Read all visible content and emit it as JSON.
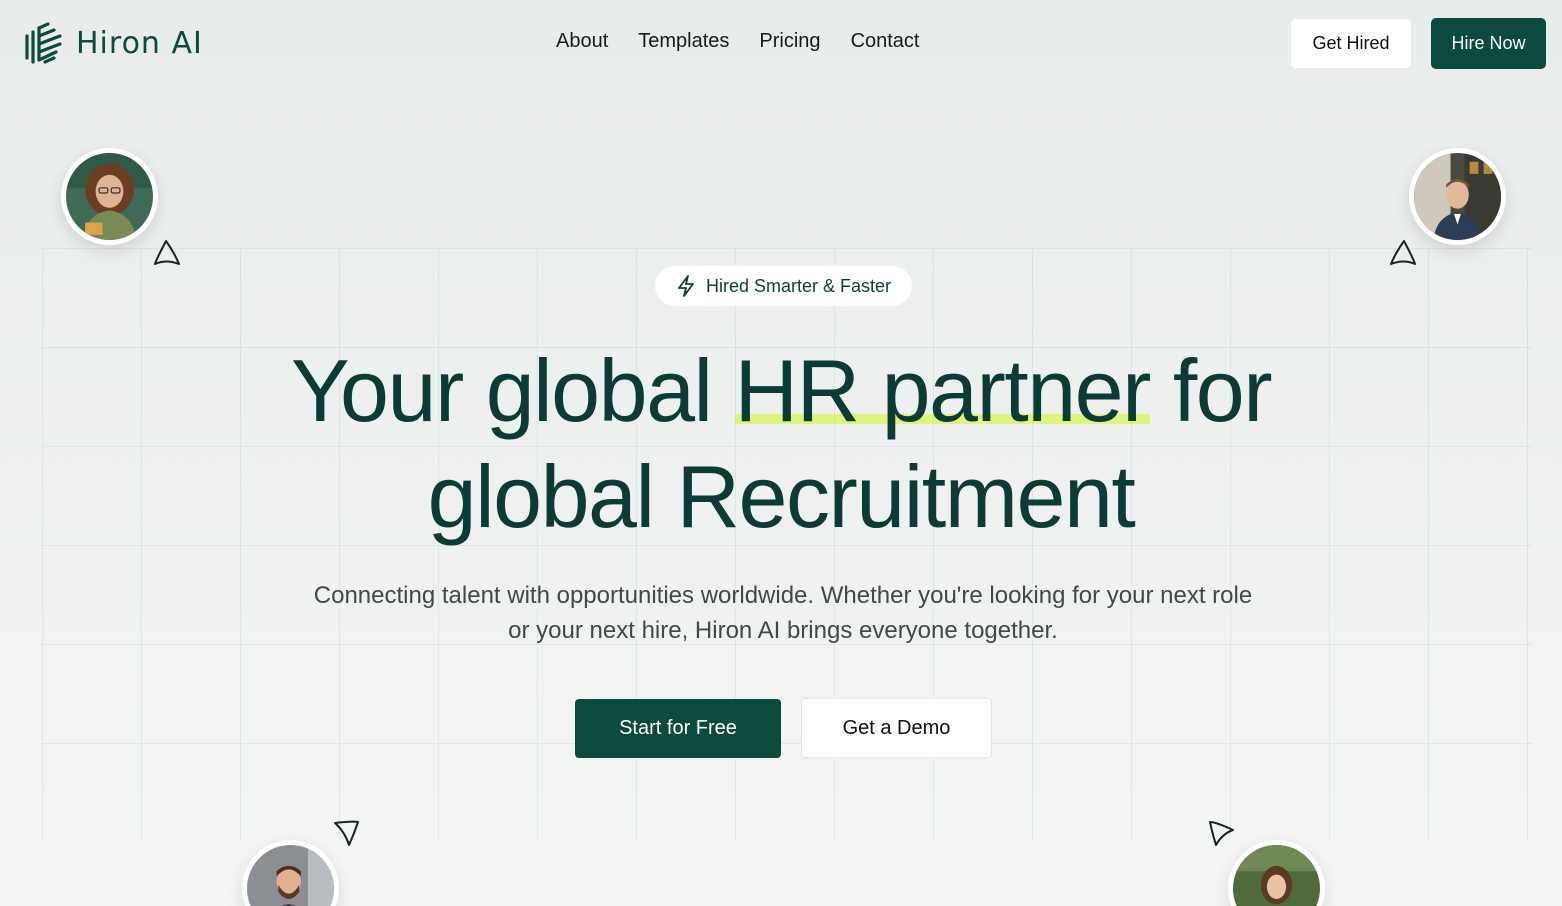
{
  "brand": {
    "name": "Hiron AI",
    "logo_icon": "hiron-logo-mark",
    "accent": "#0d4a3e",
    "highlight": "#dcf57a"
  },
  "nav": {
    "items": [
      {
        "label": "About"
      },
      {
        "label": "Templates"
      },
      {
        "label": "Pricing"
      },
      {
        "label": "Contact"
      }
    ],
    "get_hired": "Get Hired",
    "hire_now": "Hire Now"
  },
  "hero": {
    "badge": {
      "icon": "lightning-icon",
      "label": "Hired Smarter & Faster"
    },
    "headline": {
      "line1_a": "Your global ",
      "line1_highlight": "HR partner",
      "line1_b": " for",
      "line2": "global Recruitment"
    },
    "subtitle": "Connecting talent with opportunities worldwide. Whether you're looking for your next role or your next hire, Hiron AI brings everyone together.",
    "cta_primary": "Start for Free",
    "cta_secondary": "Get a Demo"
  },
  "avatars": [
    {
      "name": "woman-glasses"
    },
    {
      "name": "man-suit-building"
    },
    {
      "name": "man-beard-suit"
    },
    {
      "name": "girl-backpack"
    }
  ]
}
